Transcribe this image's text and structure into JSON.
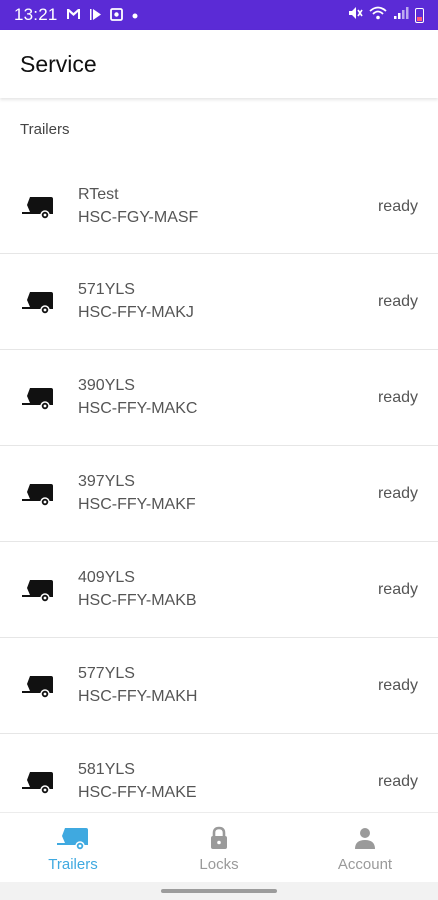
{
  "status_bar": {
    "time": "13:21",
    "left_icons": [
      "mail-icon",
      "play-icon",
      "photo-icon",
      "dot-icon"
    ],
    "right_icons": [
      "mute-icon",
      "wifi-icon",
      "signal-icon",
      "battery-icon"
    ]
  },
  "header": {
    "title": "Service"
  },
  "section": {
    "label": "Trailers"
  },
  "trailers": [
    {
      "name": "RTest",
      "code": "HSC-FGY-MASF",
      "status": "ready"
    },
    {
      "name": "571YLS",
      "code": "HSC-FFY-MAKJ",
      "status": "ready"
    },
    {
      "name": "390YLS",
      "code": "HSC-FFY-MAKC",
      "status": "ready"
    },
    {
      "name": "397YLS",
      "code": "HSC-FFY-MAKF",
      "status": "ready"
    },
    {
      "name": "409YLS",
      "code": "HSC-FFY-MAKB",
      "status": "ready"
    },
    {
      "name": "577YLS",
      "code": "HSC-FFY-MAKH",
      "status": "ready"
    },
    {
      "name": "581YLS",
      "code": "HSC-FFY-MAKE",
      "status": "ready"
    }
  ],
  "bottom_nav": [
    {
      "label": "Trailers",
      "icon": "trailer-icon",
      "active": true
    },
    {
      "label": "Locks",
      "icon": "lock-icon",
      "active": false
    },
    {
      "label": "Account",
      "icon": "person-icon",
      "active": false
    }
  ],
  "colors": {
    "status_bar": "#5b2bd6",
    "active_tab": "#3fa9e0",
    "inactive_tab": "#9a9a9a"
  }
}
